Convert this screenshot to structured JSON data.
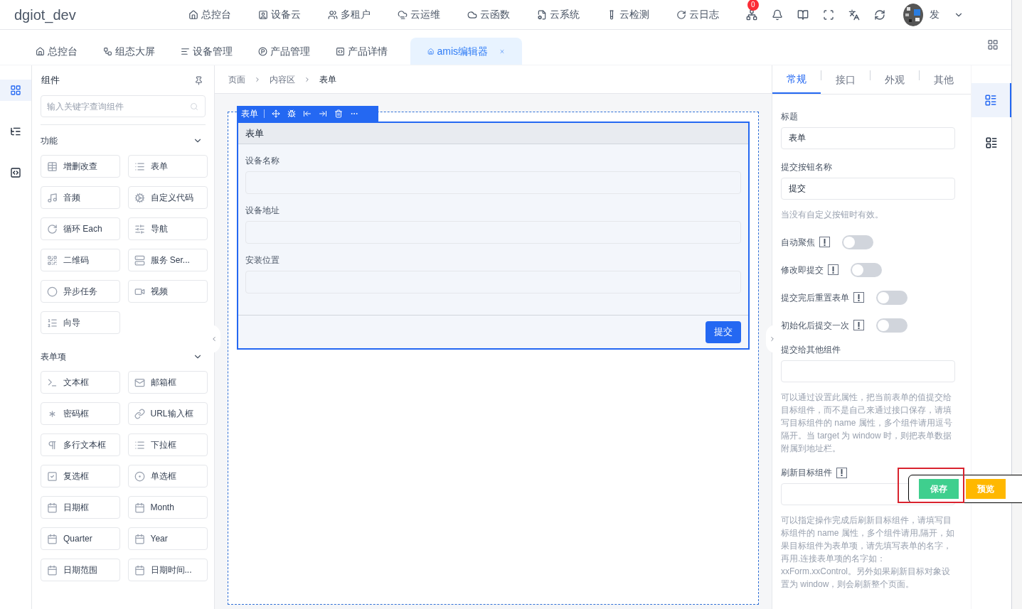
{
  "header": {
    "logo": "dgiot_dev",
    "nav": [
      "总控台",
      "设备云",
      "多租户",
      "云运维",
      "云函数",
      "云系统",
      "云检测",
      "云日志"
    ],
    "notification_badge": "0",
    "user": "发"
  },
  "tabs": [
    {
      "label": "总控台",
      "selected": false
    },
    {
      "label": "组态大屏",
      "selected": false
    },
    {
      "label": "设备管理",
      "selected": false
    },
    {
      "label": "产品管理",
      "selected": false
    },
    {
      "label": "产品详情",
      "selected": false
    },
    {
      "label": "amis编辑器",
      "selected": true
    }
  ],
  "left_rail": [
    {
      "selected": true
    },
    {
      "selected": false
    },
    {
      "selected": false
    }
  ],
  "components_panel": {
    "title": "组件",
    "search": {
      "placeholder": "输入关键字查询组件"
    },
    "groups": [
      {
        "title": "功能",
        "expanded": true,
        "items": [
          "增删改查",
          "表单",
          "音频",
          "自定义代码",
          "循环 Each",
          "导航",
          "二维码",
          "服务 Ser...",
          "异步任务",
          "视频",
          "向导"
        ]
      },
      {
        "title": "表单项",
        "expanded": true,
        "items": [
          "文本框",
          "邮箱框",
          "密码框",
          "URL输入框",
          "多行文本框",
          "下拉框",
          "复选框",
          "单选框",
          "日期框",
          "Month",
          "Quarter",
          "Year",
          "日期范围",
          "日期时间..."
        ]
      }
    ]
  },
  "breadcrumb": [
    "页面",
    "内容区",
    "表单"
  ],
  "form": {
    "toolbar_label": "表单",
    "title": "表单",
    "fields": [
      {
        "label": "设备名称"
      },
      {
        "label": "设备地址"
      },
      {
        "label": "安装位置"
      }
    ],
    "submit": "提交"
  },
  "settings": {
    "tabs": [
      {
        "label": "常规",
        "selected": true
      },
      {
        "label": "接口",
        "selected": false
      },
      {
        "label": "外观",
        "selected": false
      },
      {
        "label": "其他",
        "selected": false
      }
    ],
    "items": [
      {
        "kind": "input",
        "label": "标题",
        "value": "表单"
      },
      {
        "kind": "input",
        "label": "提交按钮名称",
        "value": "提交",
        "hint": "当没有自定义按钮时有效。"
      },
      {
        "kind": "switch",
        "label": "自动聚焦",
        "info": true,
        "on": false
      },
      {
        "kind": "switch",
        "label": "修改即提交",
        "info": true,
        "on": false
      },
      {
        "kind": "switch",
        "label": "提交完后重置表单",
        "info": true,
        "on": false
      },
      {
        "kind": "switch",
        "label": "初始化后提交一次",
        "info": true,
        "on": false
      },
      {
        "kind": "input",
        "label": "提交给其他组件",
        "hint": "可以通过设置此属性，把当前表单的值提交给目标组件，而不是自己来通过接口保存，请填写目标组件的 name 属性，多个组件请用逗号隔开。当 target 为 window 时，则把表单数据附属到地址栏。"
      },
      {
        "kind": "input",
        "label": "刷新目标组件",
        "info": true,
        "hint": "可以指定操作完成后刷新目标组件，请填写目标组件的 name 属性，多个组件请用,隔开，如果目标组件为表单项，请先填写表单的名字，再用.连接表单项的名字如：xxForm.xxControl。另外如果刷新目标对象设置为 window，则会刷新整个页面。"
      }
    ]
  },
  "right_rail": [
    {
      "selected": true
    },
    {
      "selected": false
    }
  ],
  "floating_actions": [
    "保存",
    "预览"
  ]
}
